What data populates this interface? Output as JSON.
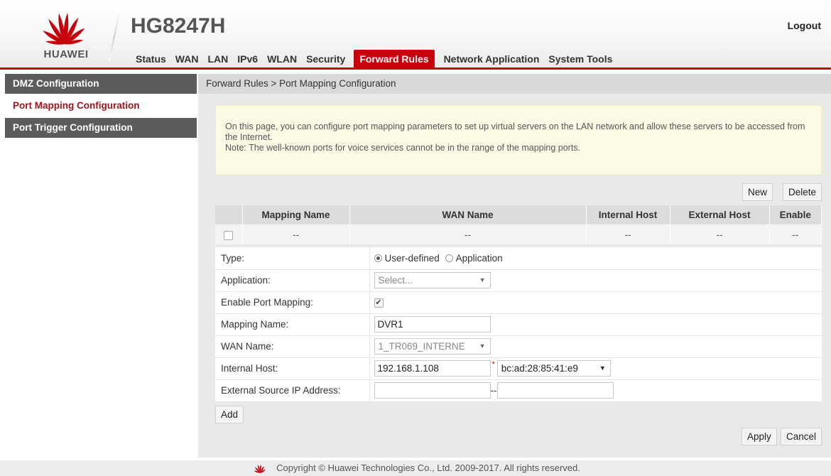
{
  "header": {
    "brand": "HUAWEI",
    "model": "HG8247H",
    "logout_label": "Logout",
    "nav": [
      {
        "label": "Status"
      },
      {
        "label": "WAN"
      },
      {
        "label": "LAN"
      },
      {
        "label": "IPv6"
      },
      {
        "label": "WLAN"
      },
      {
        "label": "Security"
      },
      {
        "label": "Forward Rules",
        "active": true
      },
      {
        "label": "Network Application"
      },
      {
        "label": "System Tools"
      }
    ]
  },
  "colors": {
    "accent": "#c7000b",
    "sidebar_dark": "#5c5c5c",
    "notice_bg": "#fbfbe5"
  },
  "sidebar": {
    "items": [
      {
        "label": "DMZ Configuration"
      },
      {
        "label": "Port Mapping Configuration",
        "active": true
      },
      {
        "label": "Port Trigger Configuration"
      }
    ]
  },
  "main": {
    "breadcrumb": "Forward Rules > Port Mapping Configuration",
    "notice_line1": "On this page, you can configure port mapping parameters to set up virtual servers on the LAN network and allow these servers to be accessed from the Internet.",
    "notice_line2": "Note: The well-known ports for voice services cannot be in the range of the mapping ports.",
    "new_label": "New",
    "delete_label": "Delete",
    "table": {
      "headers": [
        "",
        "Mapping Name",
        "WAN Name",
        "Internal Host",
        "External Host",
        "Enable"
      ],
      "row": [
        "",
        "--",
        "--",
        "--",
        "--",
        "--"
      ]
    },
    "form": {
      "type_label": "Type:",
      "type_opt1": "User-defined",
      "type_opt2": "Application",
      "type_selected": "User-defined",
      "application_label": "Application:",
      "application_value": "Select...",
      "enable_label": "Enable Port Mapping:",
      "enable_checked": true,
      "mapping_name_label": "Mapping Name:",
      "mapping_name_value": "DVR1",
      "wan_name_label": "WAN Name:",
      "wan_name_value": "1_TR069_INTERNE",
      "internal_host_label": "Internal Host:",
      "internal_host_value": "192.168.1.108",
      "internal_host_required": "*",
      "mac_value": "bc:ad:28:85:41:e9",
      "ext_src_label": "External Source IP Address:",
      "ext_src_start": "",
      "ext_src_separator": "--",
      "ext_src_end": ""
    },
    "add_label": "Add",
    "apply_label": "Apply",
    "cancel_label": "Cancel"
  },
  "footer": {
    "copyright": "Copyright © Huawei Technologies Co., Ltd. 2009-2017. All rights reserved."
  }
}
